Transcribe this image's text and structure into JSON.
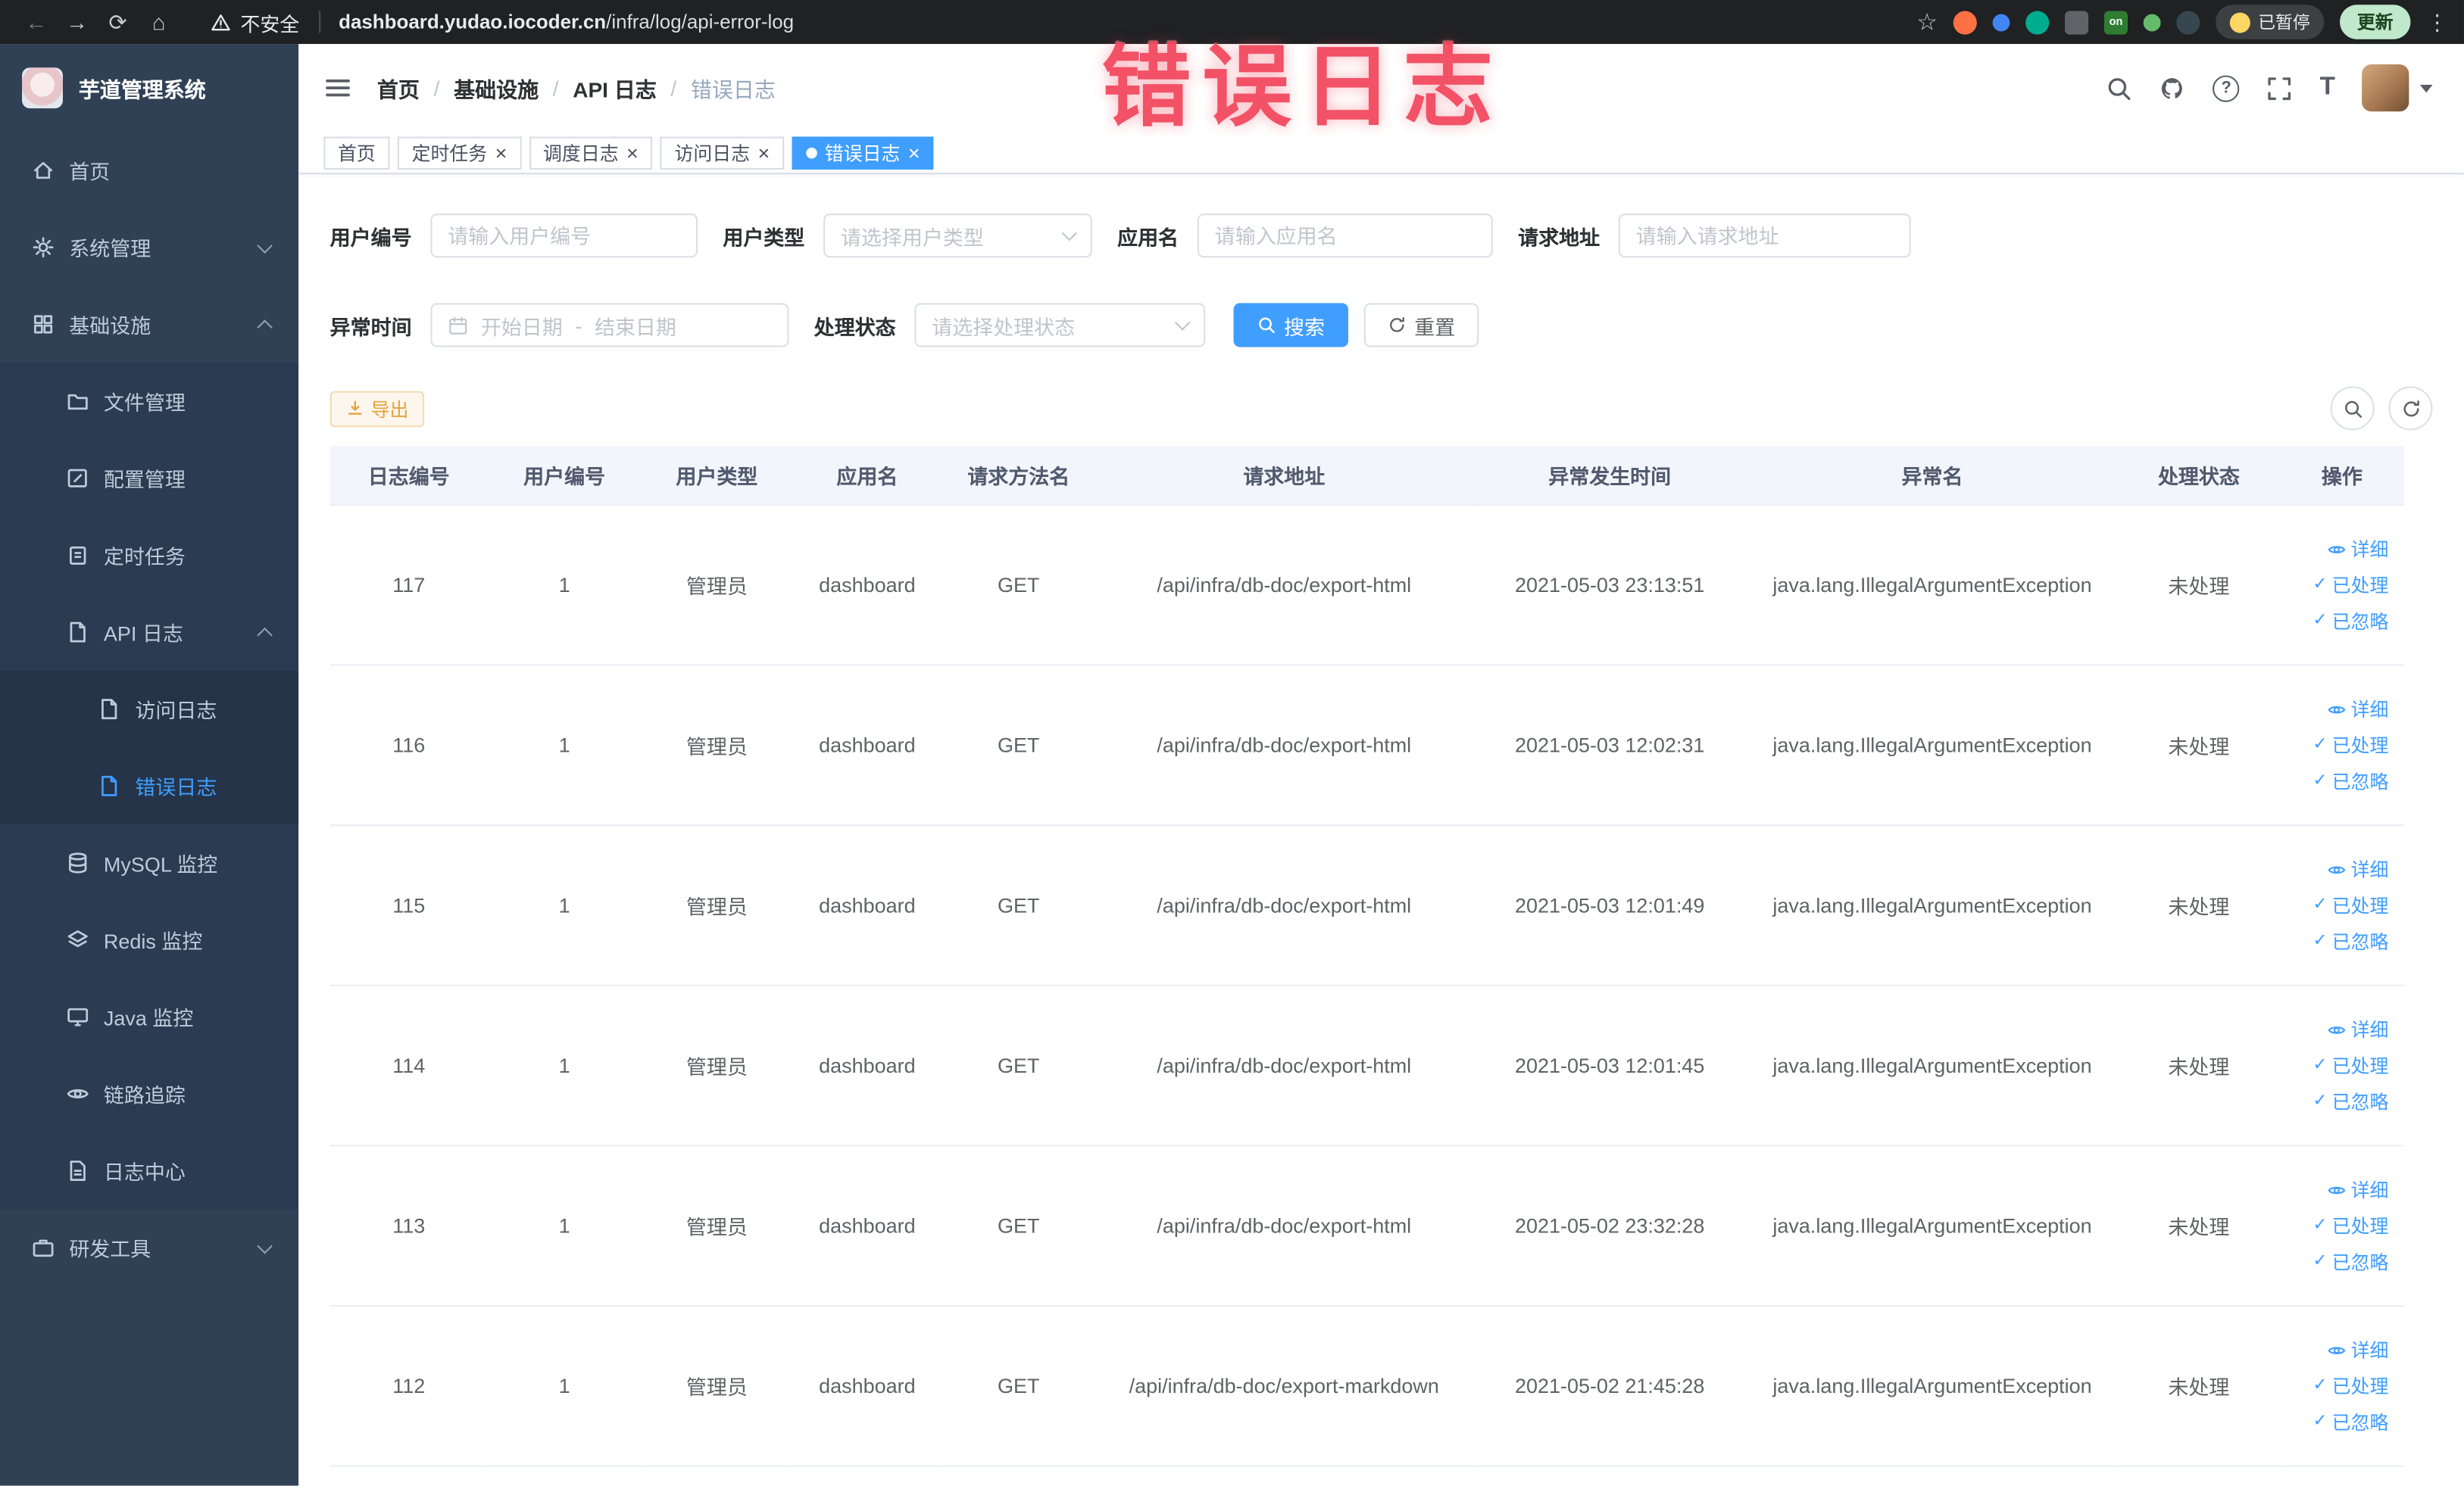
{
  "browser": {
    "security_warning": "不安全",
    "url_domain": "dashboard.yudao.iocoder.cn",
    "url_path": "/infra/log/api-error-log",
    "paused_badge": "已暂停",
    "update_button": "更新",
    "ext_on_label": "on"
  },
  "icons": {
    "back": "←",
    "forward": "→",
    "reload": "⟳",
    "home": "⌂",
    "star": "☆",
    "menu_dots": "⋮",
    "close": "×",
    "check": "✓",
    "question": "?",
    "font_size": "T"
  },
  "overlay": {
    "text": "错误日志"
  },
  "sidebar": {
    "app_title": "芋道管理系统",
    "items": {
      "home": "首页",
      "system": "系统管理",
      "infra": "基础设施",
      "file": "文件管理",
      "config": "配置管理",
      "job": "定时任务",
      "api_log": "API 日志",
      "access_log": "访问日志",
      "error_log": "错误日志",
      "mysql": "MySQL 监控",
      "redis": "Redis 监控",
      "java": "Java 监控",
      "trace": "链路追踪",
      "log_center": "日志中心",
      "dev_tools": "研发工具"
    }
  },
  "header": {
    "breadcrumb": [
      "首页",
      "基础设施",
      "API 日志",
      "错误日志"
    ],
    "separator": "/"
  },
  "tabs": [
    {
      "label": "首页"
    },
    {
      "label": "定时任务"
    },
    {
      "label": "调度日志"
    },
    {
      "label": "访问日志"
    },
    {
      "label": "错误日志"
    }
  ],
  "filters": {
    "user_id_label": "用户编号",
    "user_id_placeholder": "请输入用户编号",
    "user_type_label": "用户类型",
    "user_type_placeholder": "请选择用户类型",
    "app_name_label": "应用名",
    "app_name_placeholder": "请输入应用名",
    "request_url_label": "请求地址",
    "request_url_placeholder": "请输入请求地址",
    "time_label": "异常时间",
    "time_start_placeholder": "开始日期",
    "time_range_separator": "-",
    "time_end_placeholder": "结束日期",
    "status_label": "处理状态",
    "status_placeholder": "请选择处理状态",
    "search_button": "搜索",
    "reset_button": "重置"
  },
  "toolbar": {
    "export_button": "导出"
  },
  "table": {
    "columns": [
      "日志编号",
      "用户编号",
      "用户类型",
      "应用名",
      "请求方法名",
      "请求地址",
      "异常发生时间",
      "异常名",
      "处理状态",
      "操作"
    ],
    "actions": {
      "detail": "详细",
      "processed": "已处理",
      "ignored": "已忽略"
    },
    "rows": [
      {
        "id": "117",
        "user_id": "1",
        "user_type": "管理员",
        "app_name": "dashboard",
        "method": "GET",
        "url": "/api/infra/db-doc/export-html",
        "time": "2021-05-03 23:13:51",
        "exception": "java.lang.IllegalArgumentException",
        "status": "未处理"
      },
      {
        "id": "116",
        "user_id": "1",
        "user_type": "管理员",
        "app_name": "dashboard",
        "method": "GET",
        "url": "/api/infra/db-doc/export-html",
        "time": "2021-05-03 12:02:31",
        "exception": "java.lang.IllegalArgumentException",
        "status": "未处理"
      },
      {
        "id": "115",
        "user_id": "1",
        "user_type": "管理员",
        "app_name": "dashboard",
        "method": "GET",
        "url": "/api/infra/db-doc/export-html",
        "time": "2021-05-03 12:01:49",
        "exception": "java.lang.IllegalArgumentException",
        "status": "未处理"
      },
      {
        "id": "114",
        "user_id": "1",
        "user_type": "管理员",
        "app_name": "dashboard",
        "method": "GET",
        "url": "/api/infra/db-doc/export-html",
        "time": "2021-05-03 12:01:45",
        "exception": "java.lang.IllegalArgumentException",
        "status": "未处理"
      },
      {
        "id": "113",
        "user_id": "1",
        "user_type": "管理员",
        "app_name": "dashboard",
        "method": "GET",
        "url": "/api/infra/db-doc/export-html",
        "time": "2021-05-02 23:32:28",
        "exception": "java.lang.IllegalArgumentException",
        "status": "未处理"
      },
      {
        "id": "112",
        "user_id": "1",
        "user_type": "管理员",
        "app_name": "dashboard",
        "method": "GET",
        "url": "/api/infra/db-doc/export-markdown",
        "time": "2021-05-02 21:45:28",
        "exception": "java.lang.IllegalArgumentException",
        "status": "未处理"
      }
    ]
  },
  "colors": {
    "accent": "#409EFF",
    "warning": "#e6a23c",
    "annotation": "#f2485e",
    "sidebar_bg": "#304156"
  }
}
